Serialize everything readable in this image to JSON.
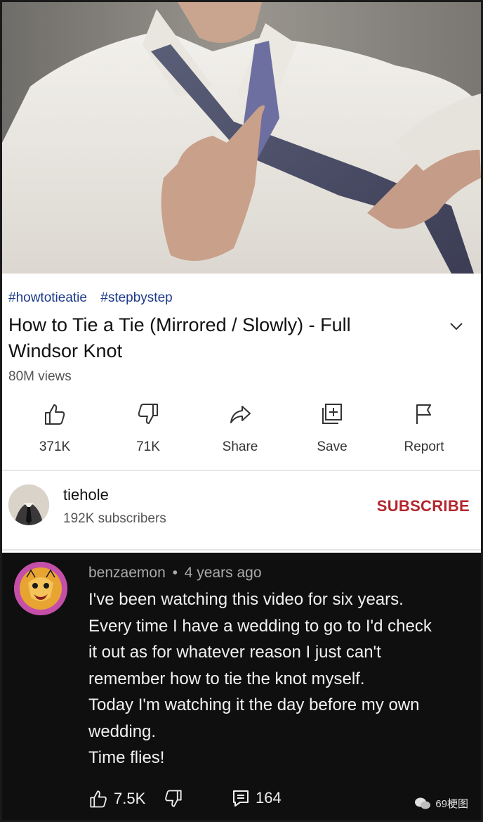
{
  "video": {
    "thumbnail_description": "tie-tying-demo-frame"
  },
  "hashtags": [
    "#howtotieatie",
    "#stepbystep"
  ],
  "title_lines": [
    "How to Tie a Tie (Mirrored / Slowly) - Full",
    "Windsor Knot"
  ],
  "views": "80M views",
  "actions": {
    "like": "371K",
    "dislike": "71K",
    "share": "Share",
    "save": "Save",
    "report": "Report"
  },
  "channel": {
    "name": "tiehole",
    "subscribers": "192K subscribers",
    "subscribe_label": "SUBSCRIBE"
  },
  "comment": {
    "author": "benzaemon",
    "separator": "•",
    "time": "4 years ago",
    "lines": [
      "I've been watching this video for six years.",
      "Every time I have a wedding to go to I'd check",
      "it out as for whatever reason I just can't",
      "remember how to tie the knot myself.",
      "Today I'm watching it the day before my own",
      "wedding.",
      "Time flies!"
    ],
    "likes": "7.5K",
    "replies": "164"
  },
  "watermark": "69梗图",
  "colors": {
    "hashtag": "#1d3a8a",
    "subscribe": "#b3262c",
    "comment_bg": "#0f0f0f"
  },
  "icons": [
    "expand-chevron-icon",
    "thumbs-up-icon",
    "thumbs-down-icon",
    "share-arrow-icon",
    "save-playlist-icon",
    "report-flag-icon",
    "reply-comment-icon"
  ]
}
